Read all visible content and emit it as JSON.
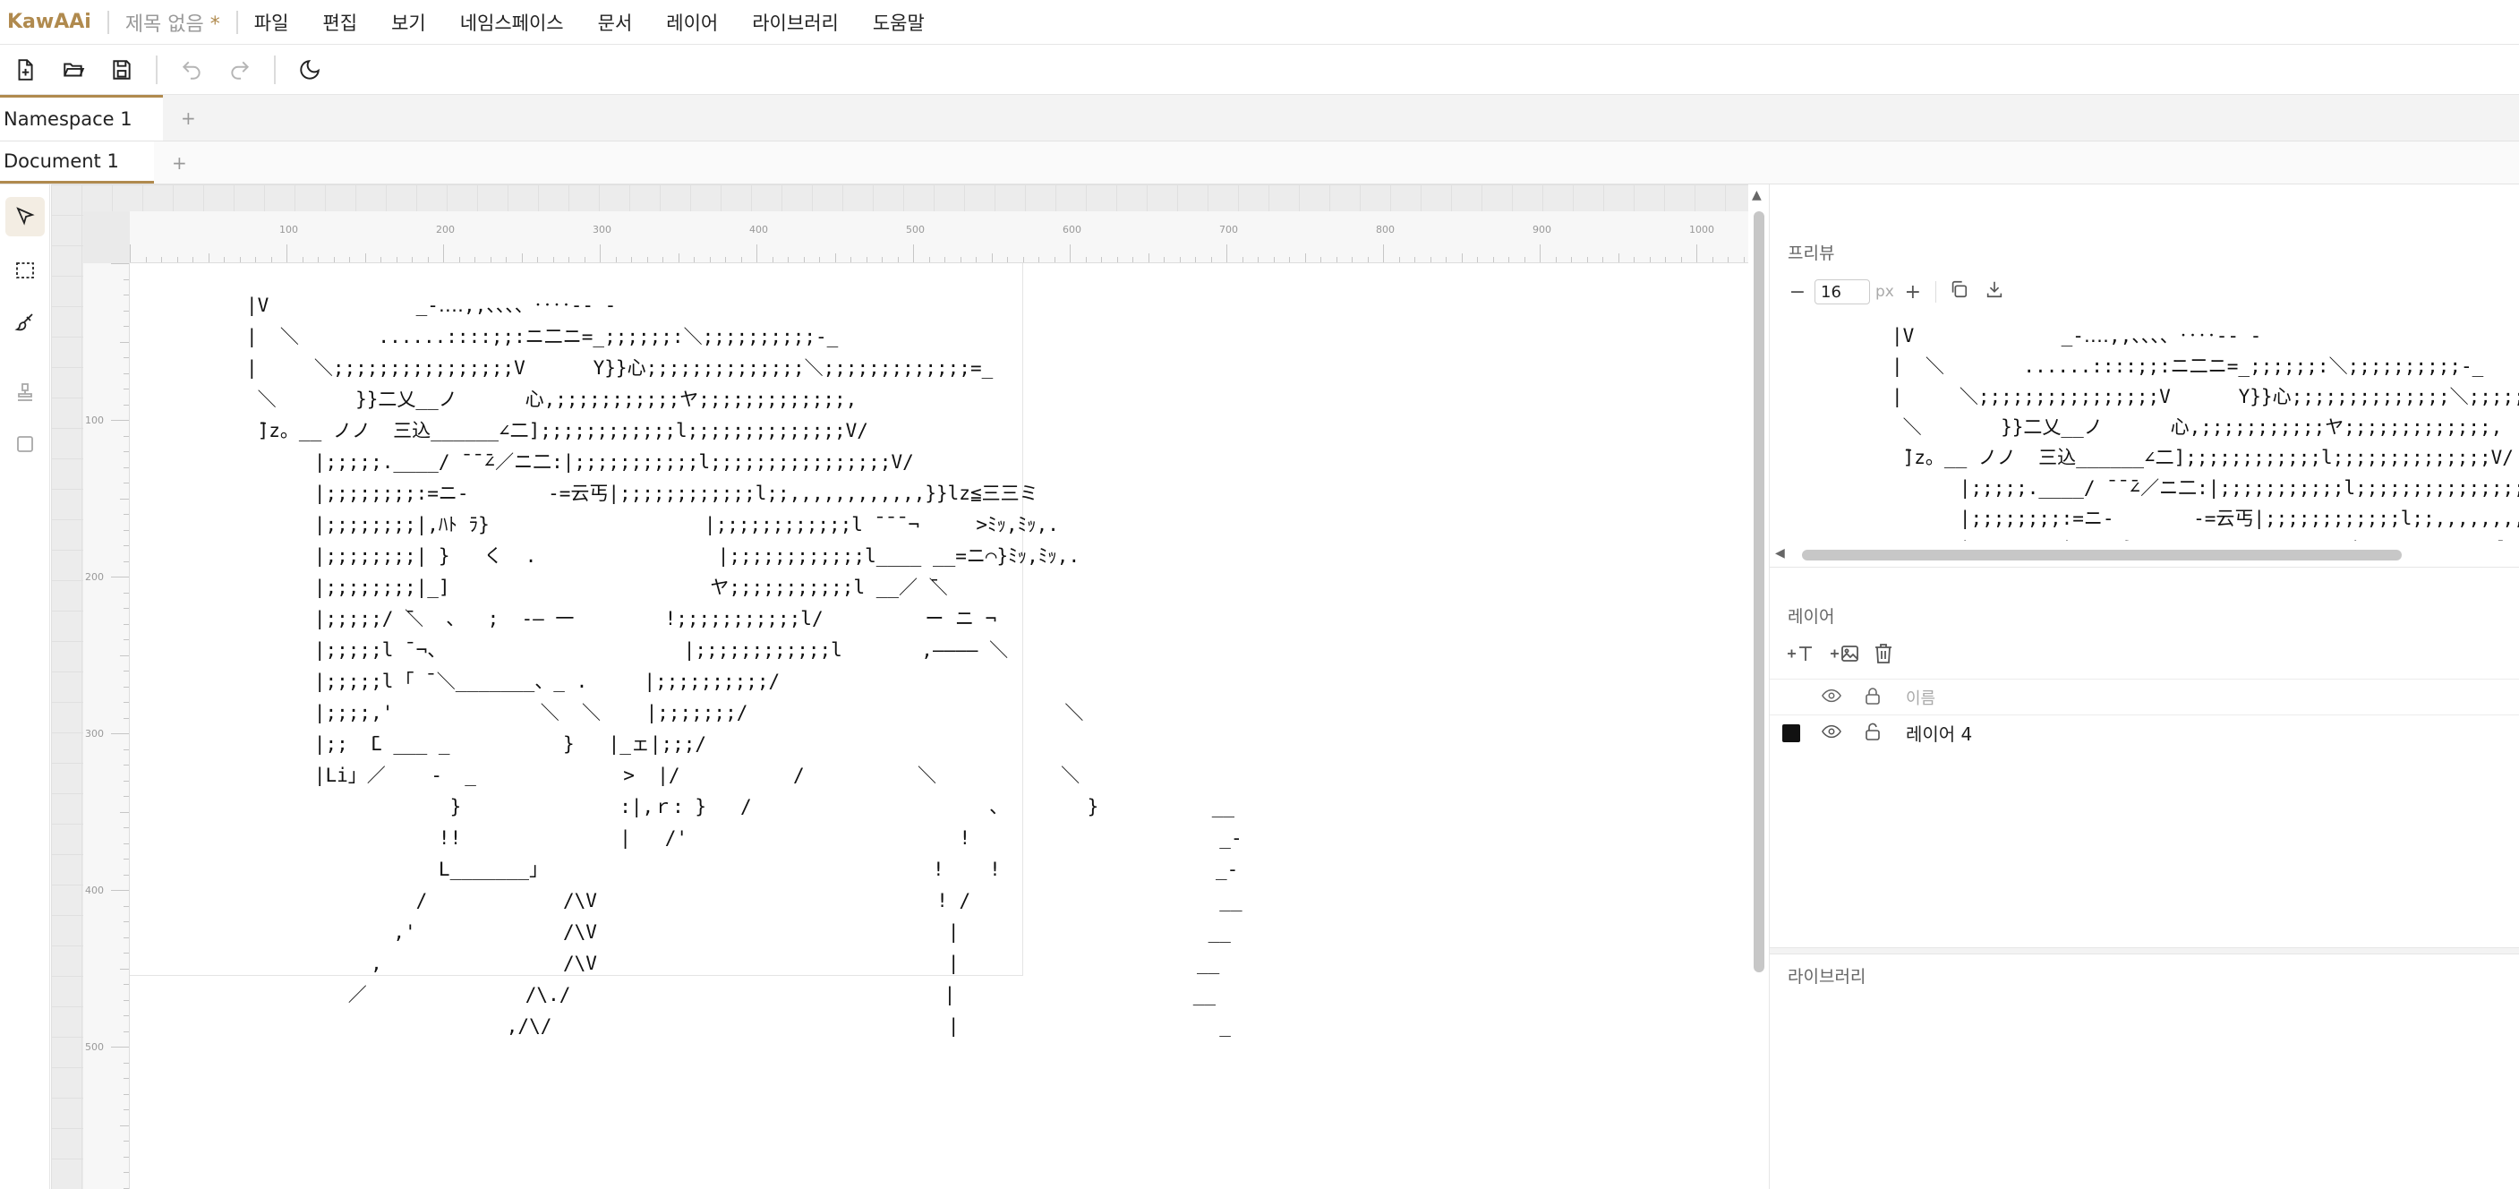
{
  "app": {
    "brand": "KawAAi",
    "doc_title": "제목 없음",
    "dirty_mark": "*"
  },
  "menu": [
    "파일",
    "편집",
    "보기",
    "네임스페이스",
    "문서",
    "레이어",
    "라이브러리",
    "도움말"
  ],
  "toolbar": {
    "icons": [
      "new-file-icon",
      "open-folder-icon",
      "save-icon",
      "undo-icon",
      "redo-icon",
      "theme-toggle-icon"
    ]
  },
  "tabs": {
    "namespace": "Namespace 1",
    "document": "Document 1",
    "add": "+"
  },
  "tools": [
    "select-tool-icon",
    "marquee-select-icon",
    "brush-icon",
    "stamp-icon",
    "square-icon"
  ],
  "ruler": {
    "h_labels": [
      "100",
      "200",
      "300",
      "400",
      "500",
      "600",
      "700",
      "800",
      "900",
      "1000"
    ],
    "v_labels": [
      "100",
      "200",
      "300",
      "400",
      "500"
    ]
  },
  "canvas": {
    "ascii_art": "|V             _-‥‥,,、、、、‥‥-- -\n|  ＼       ......::::;;:ニ二ニ=_;;;;;;:＼;;;;;;;;;;-_\n|     ＼;;;;;;;;;;;;;;;;V      Y}}心;;;;;;;;;;;;;;＼;;;;;;;;;;;;;=_\n ＼       }}二乂__ノ      心,;;;;;;;;;;;ヤ;;;;;;;;;;;;;,\n ̄]z。__ ノノ  三込______∠二];;;;;;;;;;;;l;;;;;;;;;;;;;;V/\n      |;;;;;.____/ ̄ ̄ ̄∠／ニ二:|;;;;;;;;;;;l;;;;;;;;;;;;;;;;V/\n      |;;;;;;;;:=ニ-       -=云丐|;;;;;;;;;;;;l;;,,,,,,,,,,,,}}lz≦三三ミ\n      |;;;;;;;;|,ﾊﾄ ﾗ}                   |;;;;;;;;;;;;l ̄ ̄ ̄ ¬     >ﾐｯ,ﾐｯ,.\n      |;;;;;;;;| }   く  .                |;;;;;;;;;;;;l____ __=ニ⌒}ﾐｯ,ﾐｯ,.\n      |;;;;;;;;|_]                       ヤ;;;;;;;;;;;l __／ ̄＼\n      |;;;;;/ ̄＼  、  ;  -— 一        !;;;;;;;;;;;l/         ー ニ ¬\n      |;;;;;l ¯¬、                     |;;;;;;;;;;;;l       ,———— ＼\n      |;;;;;l ｢ ¯＼_______、_ .     |;;;;;;;;;;/\n      |;;;;,'             ＼  ＼    |;;;;;;;/                            ＼\n      |;;  ̄L ___ _          }   |_ェ|;;;/\n      |Li」／    -  _             >  |/          /          ＼           ＼\n                  }              :|,ｒ: }   /                     、       }          __\n                 !!              |   /'                        !                      _-\n                 L_______」                                  !    !                   _-\n               /            /\\V                              ! /                      __\n             ,'             /\\V                               |                      __\n           ,                /\\V                               |                     __\n         ／              /\\./                                 |                     __\n                       ,/\\/                                   |                       _"
  },
  "preview": {
    "title": "프리뷰",
    "font_size": "16",
    "unit": "px",
    "ascii_art": "|V             _-‥‥,,、、、、‥‥-- -\n|  ＼       ......::::;;:ニ二ニ=_;;;;;;:＼;;;;;;;;;;-_\n|     ＼;;;;;;;;;;;;;;;;V      Y}}心;;;;;;;;;;;;;;＼;;;;;;;;;;;;;=_\n ＼       }}二乂__ノ      心,;;;;;;;;;;;ヤ;;;;;;;;;;;;;,\n ̄]z。__ ノノ  三込______∠二];;;;;;;;;;;;l;;;;;;;;;;;;;;V/\n      |;;;;;.____/ ̄ ̄ ̄∠／ニ二:|;;;;;;;;;;;l;;;;;;;;;;;;;;;;V/\n      |;;;;;;;;:=ニ-       -=云丐|;;;;;;;;;;;;l;;,,,,,,,,,,,,}}lz≦三三ミ\n      |;;;;;;;;|,ﾊﾄ ﾗ}                   |;;;;;;;;;;;;l ̄ ̄ ̄ ¬     >ﾐｯ,ﾐｯ,."
  },
  "layers": {
    "title": "레이어",
    "name_placeholder": "이름",
    "items": [
      {
        "name": "레이어 4"
      }
    ]
  },
  "library": {
    "title": "라이브러리"
  },
  "colors": {
    "accent": "#b08a4e",
    "layer_swatch": "#111111"
  }
}
